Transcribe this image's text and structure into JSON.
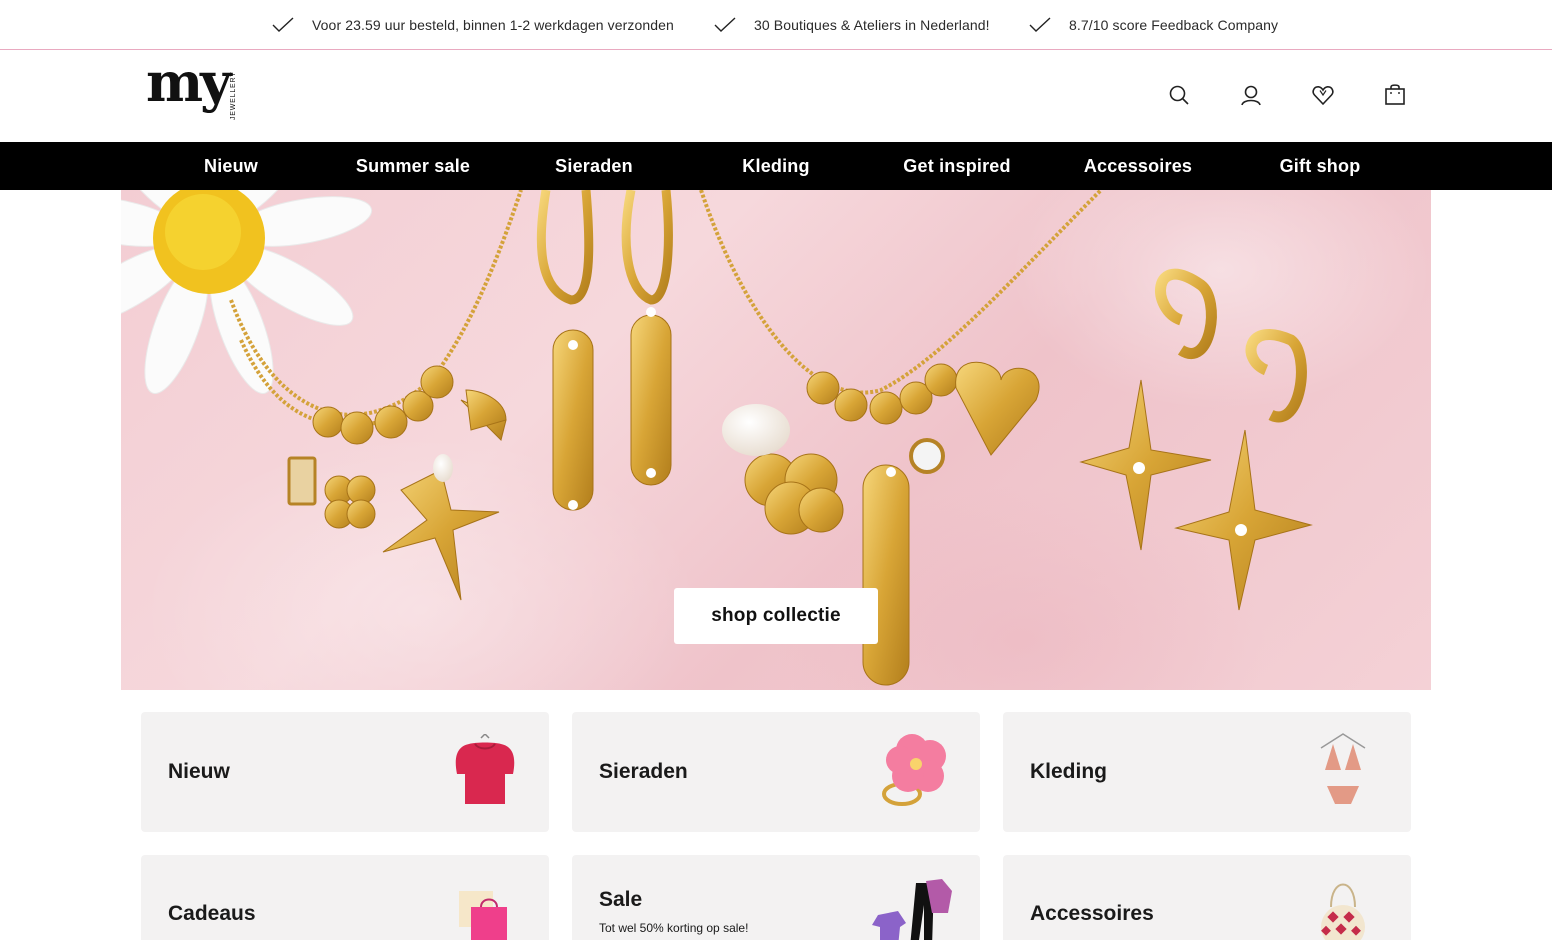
{
  "usp_bar": {
    "items": [
      {
        "text": "Voor 23.59 uur besteld, binnen 1-2 werkdagen verzonden"
      },
      {
        "text": "30 Boutiques & Ateliers in Nederland!"
      },
      {
        "text": "8.7/10 score Feedback Company"
      }
    ]
  },
  "header": {
    "logo_text": "my",
    "logo_subtext": "JEWELLERY",
    "icons": [
      "search-icon",
      "account-icon",
      "wishlist-icon",
      "cart-icon"
    ]
  },
  "nav": {
    "items": [
      {
        "label": "Nieuw"
      },
      {
        "label": "Summer sale"
      },
      {
        "label": "Sieraden"
      },
      {
        "label": "Kleding"
      },
      {
        "label": "Get inspired"
      },
      {
        "label": "Accessoires"
      },
      {
        "label": "Gift shop"
      }
    ]
  },
  "hero": {
    "cta_label": "shop collectie"
  },
  "categories": [
    {
      "name": "Nieuw",
      "subtitle": ""
    },
    {
      "name": "Sieraden",
      "subtitle": ""
    },
    {
      "name": "Kleding",
      "subtitle": ""
    },
    {
      "name": "Cadeaus",
      "subtitle": ""
    },
    {
      "name": "Sale",
      "subtitle": "Tot wel 50% korting op sale!"
    },
    {
      "name": "Accessoires",
      "subtitle": ""
    }
  ],
  "colors": {
    "nav_bg": "#000000",
    "usp_border": "#e9a9c0",
    "tile_bg": "#f3f2f2",
    "hero_pink": "#f3cdd3",
    "gold": "#d9a93a"
  }
}
